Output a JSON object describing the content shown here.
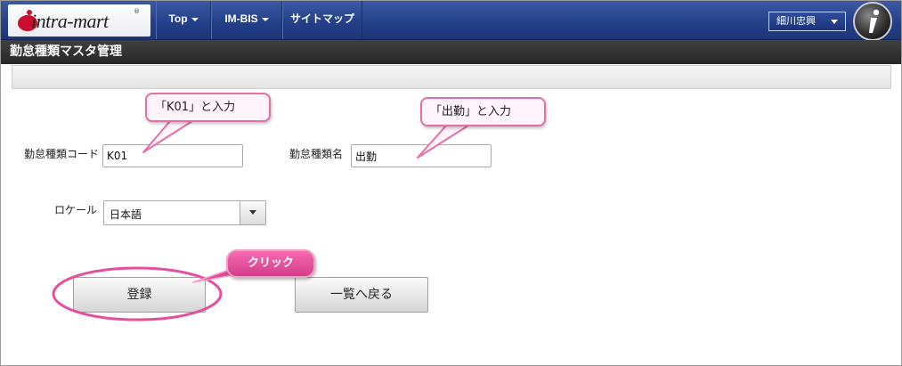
{
  "navbar": {
    "logo_text": "intra-mart",
    "logo_tm": "®",
    "items": [
      {
        "label": "Top"
      },
      {
        "label": "IM-BIS"
      },
      {
        "label": "サイトマップ"
      }
    ],
    "user_name": "細川忠興",
    "info_icon": "info-icon"
  },
  "page": {
    "title": "勤怠種類マスタ管理"
  },
  "form": {
    "code_label": "勤怠種類コード",
    "code_value": "K01",
    "name_label": "勤怠種類名",
    "name_value": "出勤",
    "locale_label": "ロケール",
    "locale_value": "日本語"
  },
  "buttons": {
    "register_label": "登録",
    "back_label": "一覧へ戻る"
  },
  "annotations": {
    "code_hint": "「K01」と入力",
    "name_hint": "「出勤」と入力",
    "click_hint": "クリック"
  },
  "colors": {
    "navbar": "#24408a",
    "titlebar": "#2f2f2f",
    "callout_border": "#e36fa8",
    "click_badge": "#e64f9e"
  }
}
